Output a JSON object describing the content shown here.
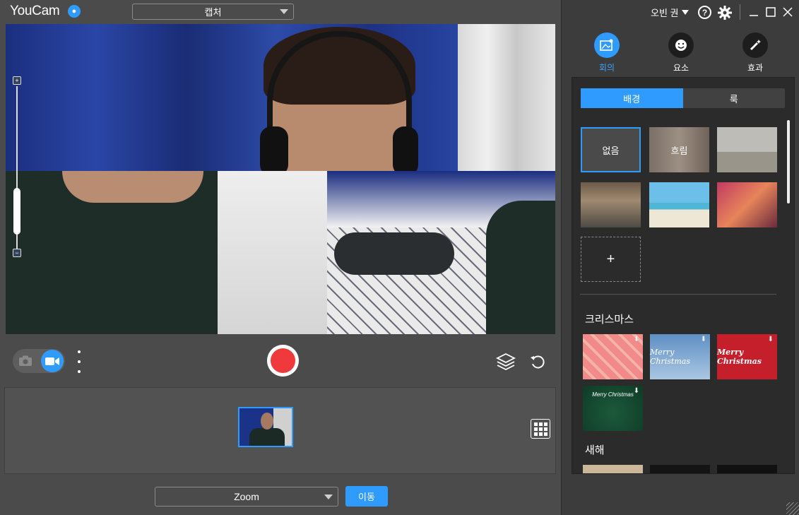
{
  "app": {
    "title": "YouCam"
  },
  "capture": {
    "selected": "캡처"
  },
  "main": {
    "zoom_plus": "+",
    "zoom_minus": "−",
    "add_symbol": "+"
  },
  "destination": {
    "selected": "Zoom",
    "go_label": "이동"
  },
  "account": {
    "user": "오빈 권"
  },
  "help": {
    "label": "?"
  },
  "panel": {
    "tabs": [
      {
        "label": "회의",
        "active": true,
        "icon": "meeting-icon"
      },
      {
        "label": "요소",
        "active": false,
        "icon": "sticker-icon"
      },
      {
        "label": "효과",
        "active": false,
        "icon": "magic-wand-icon"
      }
    ],
    "segments": [
      {
        "label": "배경",
        "active": true
      },
      {
        "label": "룩",
        "active": false
      }
    ],
    "backgrounds": [
      {
        "label": "없음"
      },
      {
        "label": "흐림"
      }
    ],
    "sections": [
      {
        "title": "크리스마스",
        "items": [
          {
            "label": ""
          },
          {
            "label": "Merry Christmas"
          },
          {
            "label": "Merry Christmas"
          },
          {
            "label": "Merry Christmas"
          }
        ]
      },
      {
        "title": "새해"
      }
    ]
  },
  "colors": {
    "accent": "#2f9bff",
    "record": "#f0393a",
    "panel_bg": "#2b2b2b",
    "app_bg": "#4b4b4b"
  }
}
